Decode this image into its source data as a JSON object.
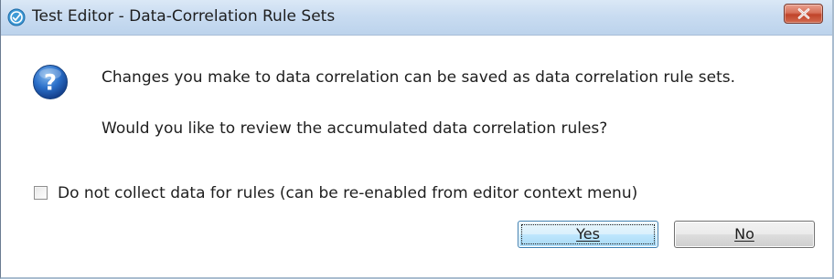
{
  "window": {
    "title": "Test Editor - Data-Correlation Rule Sets",
    "close_icon": "close-icon"
  },
  "dialog": {
    "icon": "question-icon",
    "message_line1": "Changes you make to data correlation can be saved as data correlation rule sets.",
    "message_line2": "Would you like to review the accumulated data correlation rules?"
  },
  "checkbox": {
    "label": "Do not collect data for rules (can be re-enabled from editor context menu)",
    "checked": false
  },
  "buttons": {
    "yes_label": "Yes",
    "no_label": "No"
  },
  "colors": {
    "title_bar": "#c9dcf1",
    "close_button": "#c75a40",
    "default_button_border": "#3c7fb1",
    "question_icon": "#1f5fb8"
  }
}
